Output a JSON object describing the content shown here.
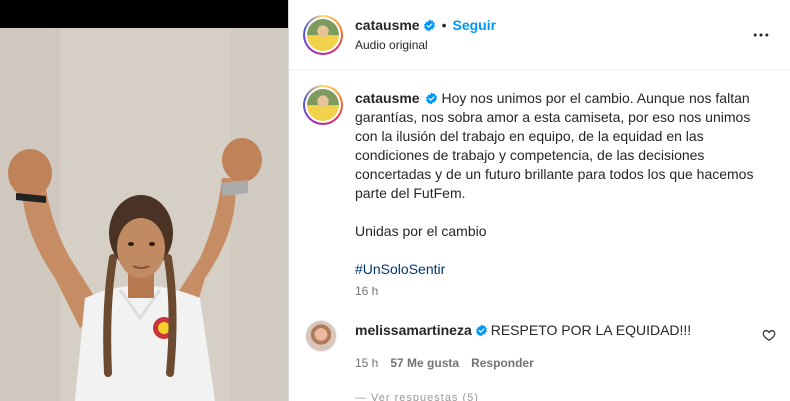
{
  "header": {
    "username": "catausme",
    "separator": "•",
    "follow_label": "Seguir",
    "audio_label": "Audio original"
  },
  "caption": {
    "username": "catausme",
    "text": "Hoy nos unimos por el cambio. Aunque nos faltan garantías, nos sobra amor a esta camiseta, por eso nos unimos con la ilusión del trabajo en equipo, de la equidad en las condiciones de trabajo y competencia, de las decisiones concertadas y de un futuro brillante para todos los que hacemos parte del FutFem.",
    "line2": "Unidas por el cambio",
    "hashtag": "#UnSoloSentir",
    "time": "16 h"
  },
  "comment": {
    "username": "melissamartineza",
    "text": "RESPETO POR LA EQUIDAD!!!",
    "time": "15 h",
    "likes": "57 Me gusta",
    "reply_label": "Responder"
  },
  "more_replies_text": "— Ver respuestas (5)",
  "colors": {
    "accent": "#0095f6",
    "verified": "#0095f6",
    "hashtag": "#00376b",
    "muted": "#737373"
  },
  "icons": {
    "verified": "verified-badge-icon",
    "more": "more-options-icon",
    "like": "heart-icon"
  }
}
